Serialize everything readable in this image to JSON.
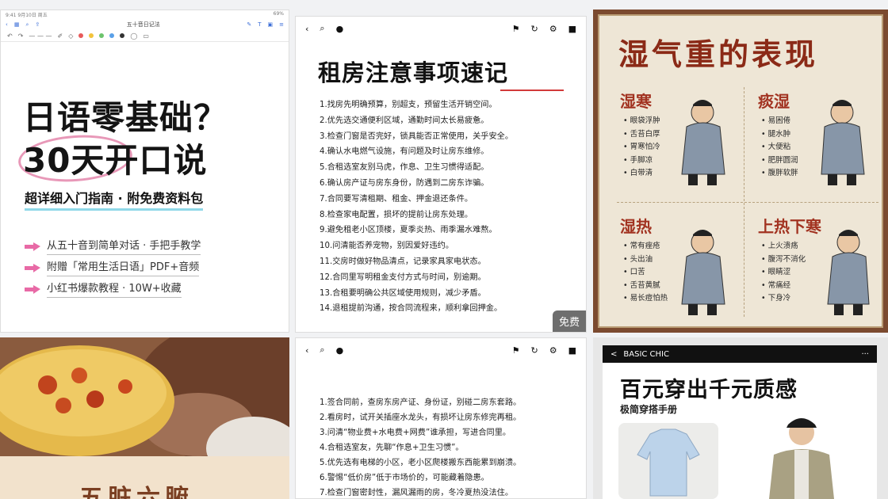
{
  "card1": {
    "status_left": "9:41  9月10日 周五",
    "status_right": "69%",
    "nav_title": "五十音日记法",
    "title_line1": "日语零基础？",
    "title_line2": "30天开口说",
    "subtitle": "超详细入门指南 · 附免费资料包",
    "bullets": [
      "从五十音到简单对话 · 手把手教学",
      "附赠「常用生活日语」PDF+音频",
      "小红书爆款教程 · 10W+收藏"
    ],
    "colors": {
      "accent": "#e86aa6",
      "underline": "#8fd8e8"
    }
  },
  "card2": {
    "title": "租房注意事项速记",
    "lines": [
      "1.找房先明确预算，别超支，预留生活开销空间。",
      "2.优先选交通便利区域，通勤时间太长易疲惫。",
      "3.检查门窗是否完好，锁具能否正常使用，关乎安全。",
      "4.确认水电燃气设施，有问题及时让房东维修。",
      "5.合租选室友别马虎，作息、卫生习惯得适配。",
      "6.确认房产证与房东身份，防遇到二房东诈骗。",
      "7.合同要写清租期、租金、押金退还条件。",
      "8.检查家电配置，损坏的提前让房东处理。",
      "9.避免租老小区顶楼，夏季炎热、雨季漏水难熬。",
      "10.问清能否养宠物，别因爱好违约。",
      "11.交房时做好物品清点，记录家具家电状态。",
      "12.合同里写明租金支付方式与时间，别逾期。",
      "13.合租要明确公共区域使用规则，减少矛盾。",
      "14.退租提前沟通，按合同流程来，顺利拿回押金。"
    ],
    "badge": "免费"
  },
  "card3": {
    "title": "湿气重的表现",
    "quadrants": [
      {
        "title": "湿寒",
        "items": [
          "眼袋浮肿",
          "舌苔白厚",
          "胃寒怕冷",
          "手脚凉",
          "白带清"
        ]
      },
      {
        "title": "痰湿",
        "items": [
          "易困倦",
          "腿水肿",
          "大便粘",
          "肥胖圆润",
          "腹胖软胖"
        ]
      },
      {
        "title": "湿热",
        "items": [
          "常有痤疮",
          "头出油",
          "口苦",
          "舌苔黄腻",
          "易长痘怕热"
        ]
      },
      {
        "title": "上热下寒",
        "items": [
          "上火溃疡",
          "腹泻不消化",
          "眼睛涩",
          "常痛经",
          "下身冷"
        ]
      }
    ],
    "colors": {
      "frame": "#7b4a2f",
      "paper": "#eee6d6",
      "red": "#a23321"
    }
  },
  "card4": {
    "caption": "五脏六腑"
  },
  "card5": {
    "lines": [
      "1.签合同前，查房东房产证、身份证，别碰二房东套路。",
      "2.看房时，试开关插座水龙头，有损坏让房东修完再租。",
      "3.问清“物业费+水电费+网费”谁承担，写进合同里。",
      "4.合租选室友，先聊“作息+卫生习惯”。",
      "5.优先选有电梯的小区，老小区爬楼搬东西能累到崩溃。",
      "6.警惕“低价房”低于市场价的，可能藏着隐患。",
      "7.检查门窗密封性，漏风漏雨的房，冬冷夏热没法住。"
    ]
  },
  "card6": {
    "nav_back": "<",
    "nav_title": "BASIC CHIC",
    "nav_more": "···",
    "title": "百元穿出千元质感",
    "subtitle": "极简穿搭手册"
  }
}
